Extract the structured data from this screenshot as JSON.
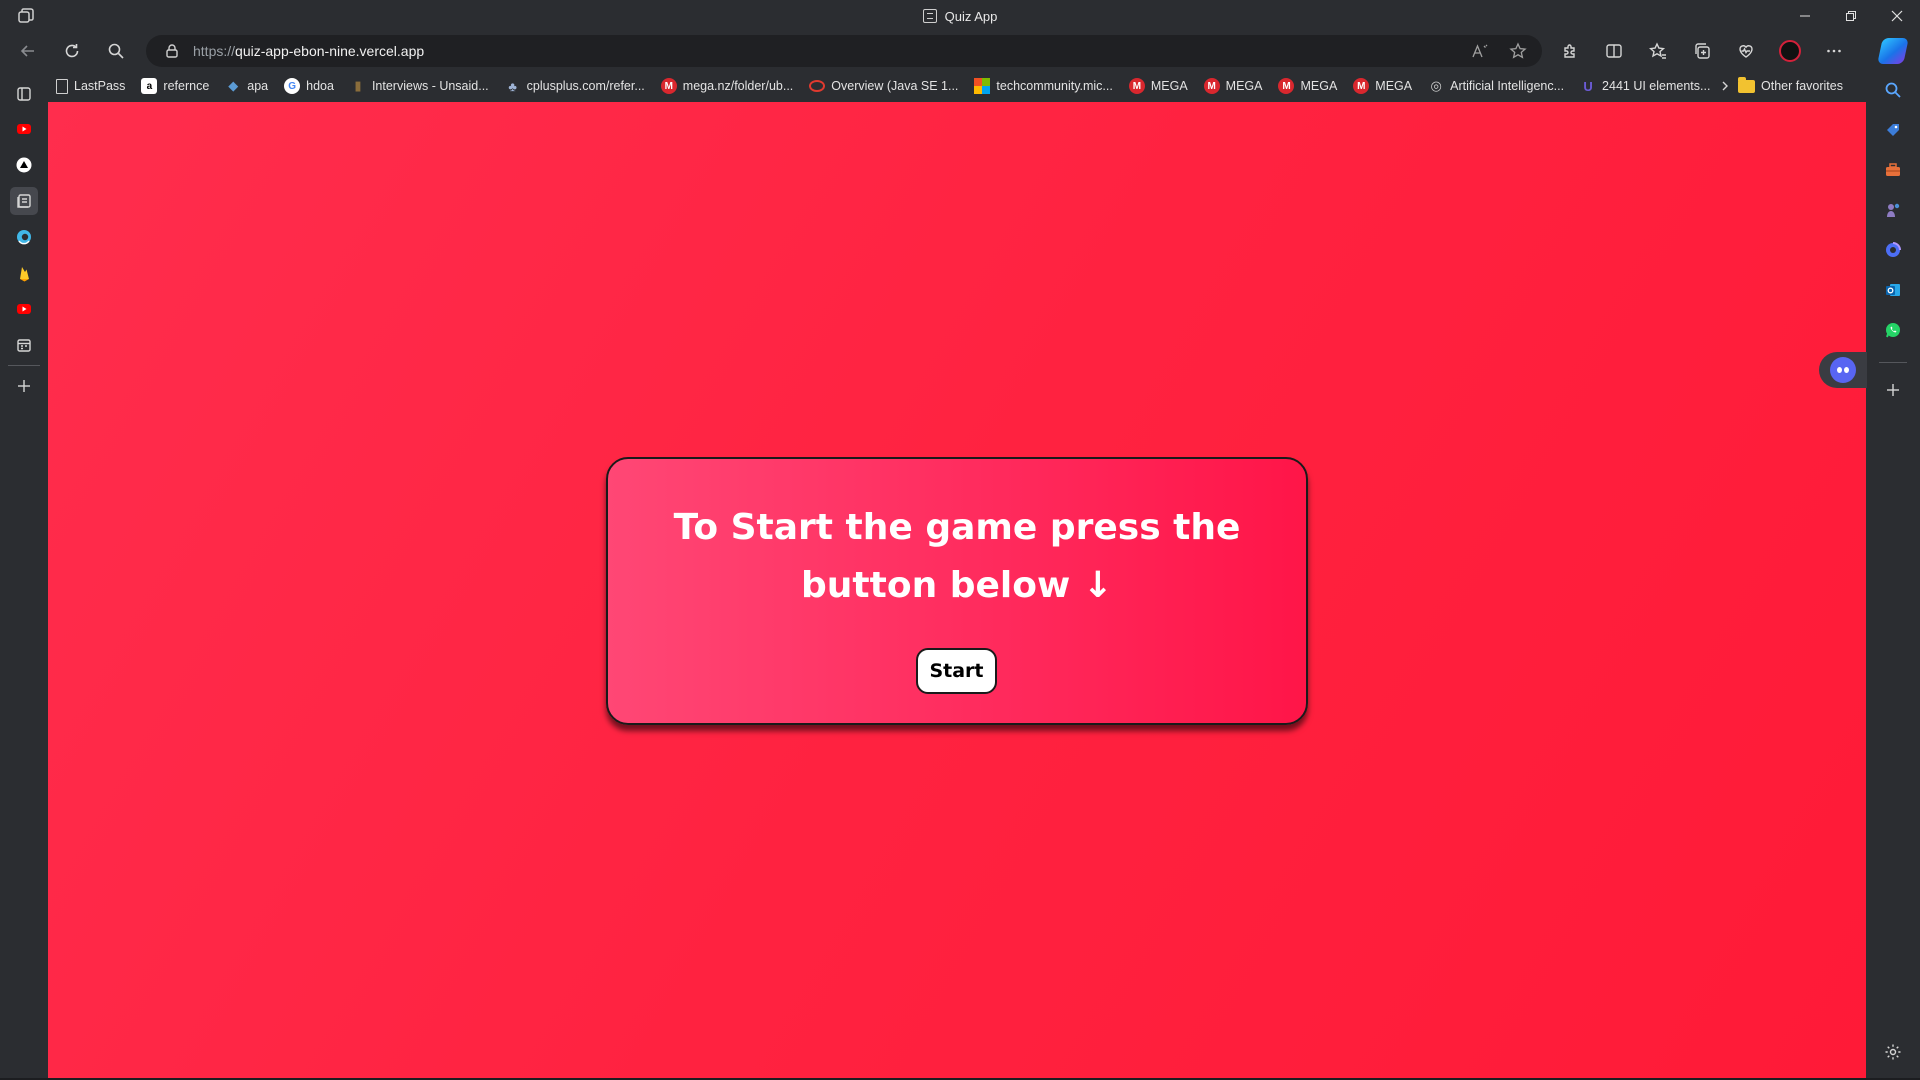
{
  "window": {
    "title": "Quiz App"
  },
  "address_bar": {
    "protocol": "https://",
    "domain": "quiz-app-ebon-nine.vercel.app"
  },
  "bookmarks": [
    {
      "label": "LastPass",
      "icon": "page-icon",
      "color": "#cfcfcf"
    },
    {
      "label": "refernce",
      "icon": "amazon-icon",
      "color": "#ffffff"
    },
    {
      "label": "apa",
      "icon": "academic-cap-icon",
      "color": "#5b9bd5"
    },
    {
      "label": "hdoa",
      "icon": "google-icon",
      "color": "#ffffff"
    },
    {
      "label": "Interviews - Unsaid...",
      "icon": "interviews-icon",
      "color": "#8a6d3b"
    },
    {
      "label": "cplusplus.com/refer...",
      "icon": "cplusplus-icon",
      "color": "#9fb4d6"
    },
    {
      "label": "mega.nz/folder/ub...",
      "icon": "mega-icon",
      "color": "#d9272e"
    },
    {
      "label": "Overview (Java SE 1...",
      "icon": "oracle-icon",
      "color": "#e03a2f"
    },
    {
      "label": "techcommunity.mic...",
      "icon": "microsoft-icon",
      "color": "#f25022"
    },
    {
      "label": "MEGA",
      "icon": "mega-icon",
      "color": "#d9272e"
    },
    {
      "label": "MEGA",
      "icon": "mega-icon",
      "color": "#d9272e"
    },
    {
      "label": "MEGA",
      "icon": "mega-icon",
      "color": "#d9272e"
    },
    {
      "label": "MEGA",
      "icon": "mega-icon",
      "color": "#d9272e"
    },
    {
      "label": "Artificial Intelligenc...",
      "icon": "globe-icon",
      "color": "#cfcfcf"
    },
    {
      "label": "2441 UI elements...",
      "icon": "ui-icon",
      "color": "#6b5bd6"
    }
  ],
  "other_favorites": "Other favorites",
  "page": {
    "heading": "To Start the game press the button below ↓",
    "start_button": "Start"
  },
  "colors": {
    "background": "#ff2240",
    "card_start": "#ff4775",
    "card_end": "#ff1548",
    "button": "#ffffff"
  }
}
